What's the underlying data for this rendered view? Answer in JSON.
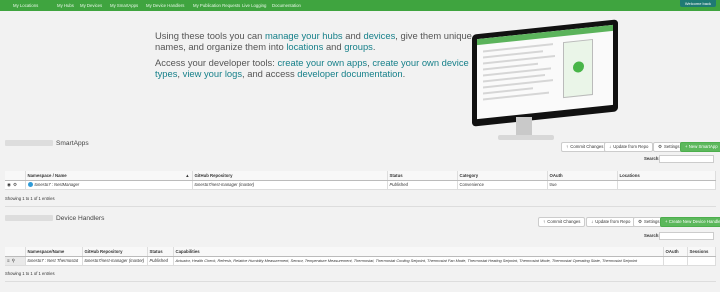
{
  "topnav": {
    "items": [
      "My Locations",
      "My Hubs",
      "My Devices",
      "My SmartApps",
      "My Device Handlers",
      "My Publication Requests",
      "Live Logging",
      "Documentation"
    ],
    "welcome": "Welcome back"
  },
  "hero": {
    "line1_pre": "Using these tools you can ",
    "line1_link1": "manage your hubs",
    "line1_mid": " and ",
    "line1_link2": "devices",
    "line1_post": ", give them unique names, and organize them into ",
    "line1_link3": "locations",
    "line1_and": " and ",
    "line1_link4": "groups",
    "line1_end": ".",
    "line2_pre": "Access your developer tools: ",
    "line2_link1": "create your own apps",
    "line2_c1": ", ",
    "line2_link2": "create your own device types",
    "line2_c2": ", ",
    "line2_link3": "view your logs",
    "line2_c3": ", and access ",
    "line2_link4": "developer documentation",
    "line2_end": "."
  },
  "smartapps": {
    "title": "SmartApps",
    "buttons": {
      "commit": "Commit Changes",
      "update": "Update from Repo",
      "settings": "Settings",
      "new": "+ New SmartApp"
    },
    "search_label": "Search:",
    "columns": [
      "",
      "Namespace / Name",
      "GitHub Repository",
      "Status",
      "Category",
      "OAuth",
      "Locations"
    ],
    "rows": [
      {
        "namespace_name": "tonesto7 : NestManager",
        "repo": "tonesto7/nest-manager (master)",
        "status": "Published",
        "category": "Convenience",
        "oauth": "true",
        "locations": ""
      }
    ],
    "showing": "Showing 1 to 1 of 1 entries"
  },
  "device_handlers": {
    "title": "Device Handlers",
    "buttons": {
      "commit": "Commit Changes",
      "update": "Update from Repo",
      "settings": "Settings",
      "new": "+ Create New Device Handler"
    },
    "search_label": "Search:",
    "columns": [
      "",
      "Namespace/Name",
      "GitHub Repository",
      "Status",
      "Capabilities",
      "OAuth",
      "Sessions"
    ],
    "rows": [
      {
        "namespace_name": "tonesto7 : Nest Thermostat",
        "repo": "tonesto7/nest-manager (master)",
        "status": "Published",
        "capabilities": "Actuator, Health Check, Refresh, Relative Humidity Measurement, Sensor, Temperature Measurement, Thermostat, Thermostat Cooling Setpoint, Thermostat Fan Mode, Thermostat Heating Setpoint, Thermostat Mode, Thermostat Operating State, Thermostat Setpoint",
        "oauth": "",
        "sessions": ""
      }
    ],
    "showing": "Showing 1 to 1 of 1 entries"
  },
  "colors": {
    "nav": "#3fa43f",
    "link": "#17808a",
    "green_button": "#5cb85c",
    "welcome": "#1f7a74"
  },
  "icons": [
    "eye-icon",
    "gear-icon",
    "hamburger-icon",
    "search-icon",
    "upload-icon",
    "download-icon",
    "sort-icon"
  ]
}
